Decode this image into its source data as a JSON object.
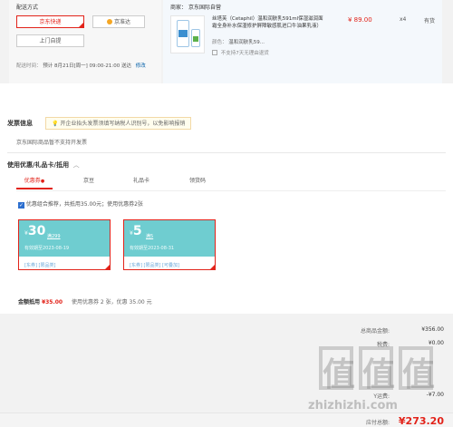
{
  "delivery": {
    "section_title": "配送方式",
    "options": [
      "京东快递",
      "京准达",
      "上门自提"
    ],
    "time_label": "配送时间：",
    "time_value": "预计 8月21日[周一] 09:00-21:00 送达",
    "modify": "修改"
  },
  "product": {
    "seller_label": "商家：",
    "seller": "京东国际自营",
    "name": "丝塔芙（Cetaphil）温和润肤乳591ml保湿滋润面霜全身补水保湿修护屏障敏感肌进口牛油果乳液）",
    "price": "¥ 89.00",
    "quantity": "x4",
    "stock": "有货",
    "spec_label": "颜色：",
    "spec_value": "温和润肤乳59...",
    "return_note": "不支持7天无理由退货"
  },
  "invoice": {
    "title": "发票信息",
    "notice": "开企业抬头发票须填写纳税人识别号，以免影响报销",
    "note": "京东国际商品暂不支持开发票"
  },
  "discount": {
    "title": "使用优惠/礼品卡/抵用",
    "tabs": [
      "优惠券",
      "京豆",
      "礼品卡",
      "领货码"
    ],
    "combo_text": "优惠组合推荐，共抵用35.00元；使用优惠券2张",
    "coupons": [
      {
        "symbol": "¥",
        "amount": "30",
        "condition": "满299",
        "date": "有效期至2023-08-19",
        "tags": [
          "[东券]",
          "[限品类]"
        ]
      },
      {
        "symbol": "¥",
        "amount": "5",
        "condition": "满5",
        "date": "有效期至2023-08-31",
        "tags": [
          "[东券]",
          "[限品类]",
          "[可叠加]"
        ]
      }
    ],
    "amount_label": "金额抵用",
    "amount_value": "¥35.00",
    "amount_detail": "使用优惠券 2 张，优惠 35.00 元"
  },
  "summary": {
    "rows": [
      {
        "label": "总商品金额:",
        "value": "¥356.00"
      },
      {
        "label": "税费:",
        "value": "¥0.00"
      }
    ],
    "partial_label": "Y运费:",
    "partial_value": "-¥7.00",
    "payable_label": "应付总额:",
    "payable_value": "¥273.20"
  },
  "watermark": {
    "domain": "zhizhizhi.com",
    "glyphs": [
      "值",
      "值",
      "值"
    ]
  },
  "colors": {
    "accent": "#e2231a",
    "coupon": "#6fcdd0"
  }
}
